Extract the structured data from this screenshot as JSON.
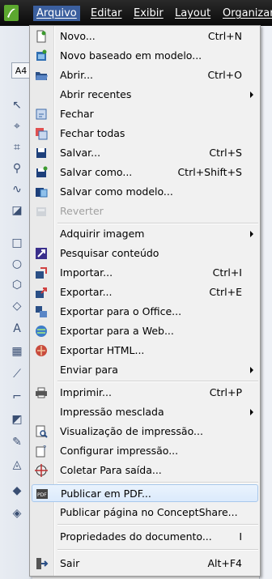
{
  "menubar": {
    "items": [
      "Arquivo",
      "Editar",
      "Exibir",
      "Layout",
      "Organizar"
    ]
  },
  "toolbar": {
    "paper_size": "A4"
  },
  "menu": {
    "items": [
      {
        "label": "Novo...",
        "shortcut": "Ctrl+N",
        "icon": "new-document-icon",
        "enabled": true,
        "submenu": false
      },
      {
        "label": "Novo baseado em modelo...",
        "shortcut": "",
        "icon": "new-from-template-icon",
        "enabled": true,
        "submenu": false
      },
      {
        "label": "Abrir...",
        "shortcut": "Ctrl+O",
        "icon": "open-folder-icon",
        "enabled": true,
        "submenu": false
      },
      {
        "label": "Abrir recentes",
        "shortcut": "",
        "icon": "",
        "enabled": true,
        "submenu": true
      },
      {
        "label": "Fechar",
        "shortcut": "",
        "icon": "close-document-icon",
        "enabled": true,
        "submenu": false
      },
      {
        "label": "Fechar todas",
        "shortcut": "",
        "icon": "close-all-icon",
        "enabled": true,
        "submenu": false
      },
      {
        "label": "Salvar...",
        "shortcut": "Ctrl+S",
        "icon": "save-icon",
        "enabled": true,
        "submenu": false
      },
      {
        "label": "Salvar como...",
        "shortcut": "Ctrl+Shift+S",
        "icon": "save-as-icon",
        "enabled": true,
        "submenu": false
      },
      {
        "label": "Salvar como modelo...",
        "shortcut": "",
        "icon": "save-template-icon",
        "enabled": true,
        "submenu": false
      },
      {
        "label": "Reverter",
        "shortcut": "",
        "icon": "revert-icon",
        "enabled": false,
        "submenu": false
      },
      {
        "label": "Adquirir imagem",
        "shortcut": "",
        "icon": "",
        "enabled": true,
        "submenu": true
      },
      {
        "label": "Pesquisar conteúdo",
        "shortcut": "",
        "icon": "search-content-icon",
        "enabled": true,
        "submenu": false
      },
      {
        "label": "Importar...",
        "shortcut": "Ctrl+I",
        "icon": "import-icon",
        "enabled": true,
        "submenu": false
      },
      {
        "label": "Exportar...",
        "shortcut": "Ctrl+E",
        "icon": "export-icon",
        "enabled": true,
        "submenu": false
      },
      {
        "label": "Exportar para o Office...",
        "shortcut": "",
        "icon": "export-office-icon",
        "enabled": true,
        "submenu": false
      },
      {
        "label": "Exportar para a Web...",
        "shortcut": "",
        "icon": "export-web-icon",
        "enabled": true,
        "submenu": false
      },
      {
        "label": "Exportar HTML...",
        "shortcut": "",
        "icon": "export-html-icon",
        "enabled": true,
        "submenu": false
      },
      {
        "label": "Enviar para",
        "shortcut": "",
        "icon": "",
        "enabled": true,
        "submenu": true
      },
      {
        "label": "Imprimir...",
        "shortcut": "Ctrl+P",
        "icon": "print-icon",
        "enabled": true,
        "submenu": false
      },
      {
        "label": "Impressão mesclada",
        "shortcut": "",
        "icon": "",
        "enabled": true,
        "submenu": true
      },
      {
        "label": "Visualização de impressão...",
        "shortcut": "",
        "icon": "print-preview-icon",
        "enabled": true,
        "submenu": false
      },
      {
        "label": "Configurar impressão...",
        "shortcut": "",
        "icon": "print-setup-icon",
        "enabled": true,
        "submenu": false
      },
      {
        "label": "Coletar Para saída...",
        "shortcut": "",
        "icon": "collect-output-icon",
        "enabled": true,
        "submenu": false
      },
      {
        "label": "Publicar em PDF...",
        "shortcut": "",
        "icon": "pdf-icon",
        "enabled": true,
        "submenu": false
      },
      {
        "label": "Publicar página no ConceptShare...",
        "shortcut": "",
        "icon": "",
        "enabled": true,
        "submenu": false
      },
      {
        "label": "Propriedades do documento...",
        "shortcut": "I",
        "icon": "",
        "enabled": true,
        "submenu": false
      },
      {
        "label": "Sair",
        "shortcut": "Alt+F4",
        "icon": "exit-icon",
        "enabled": true,
        "submenu": false
      }
    ],
    "highlighted_index": 23
  },
  "colors": {
    "menubar": "#111111",
    "active_menu": "#3b5f9e",
    "highlight": "#dbeafc",
    "disabled_text": "#a0a0a0"
  }
}
